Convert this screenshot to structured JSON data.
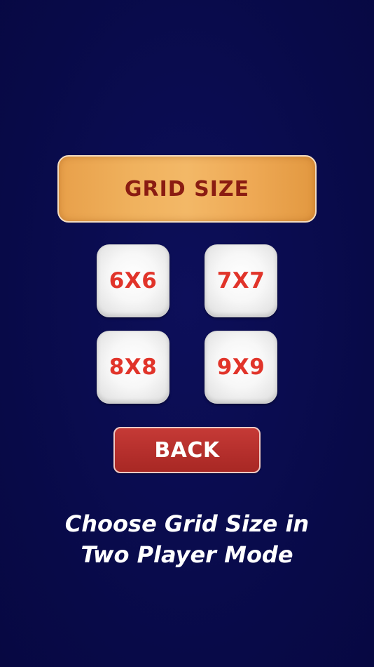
{
  "screen": {
    "title": "GRID SIZE",
    "grid_options": [
      {
        "label": "6X6"
      },
      {
        "label": "7X7"
      },
      {
        "label": "8X8"
      },
      {
        "label": "9X9"
      }
    ],
    "back_label": "BACK",
    "caption_line1": "Choose Grid Size in",
    "caption_line2": "Two Player Mode"
  },
  "colors": {
    "background": "#0a0b4e",
    "banner": "#f0b25e",
    "banner_text": "#8a1c12",
    "tile_text": "#e1342a",
    "back_button": "#b52f2c"
  }
}
